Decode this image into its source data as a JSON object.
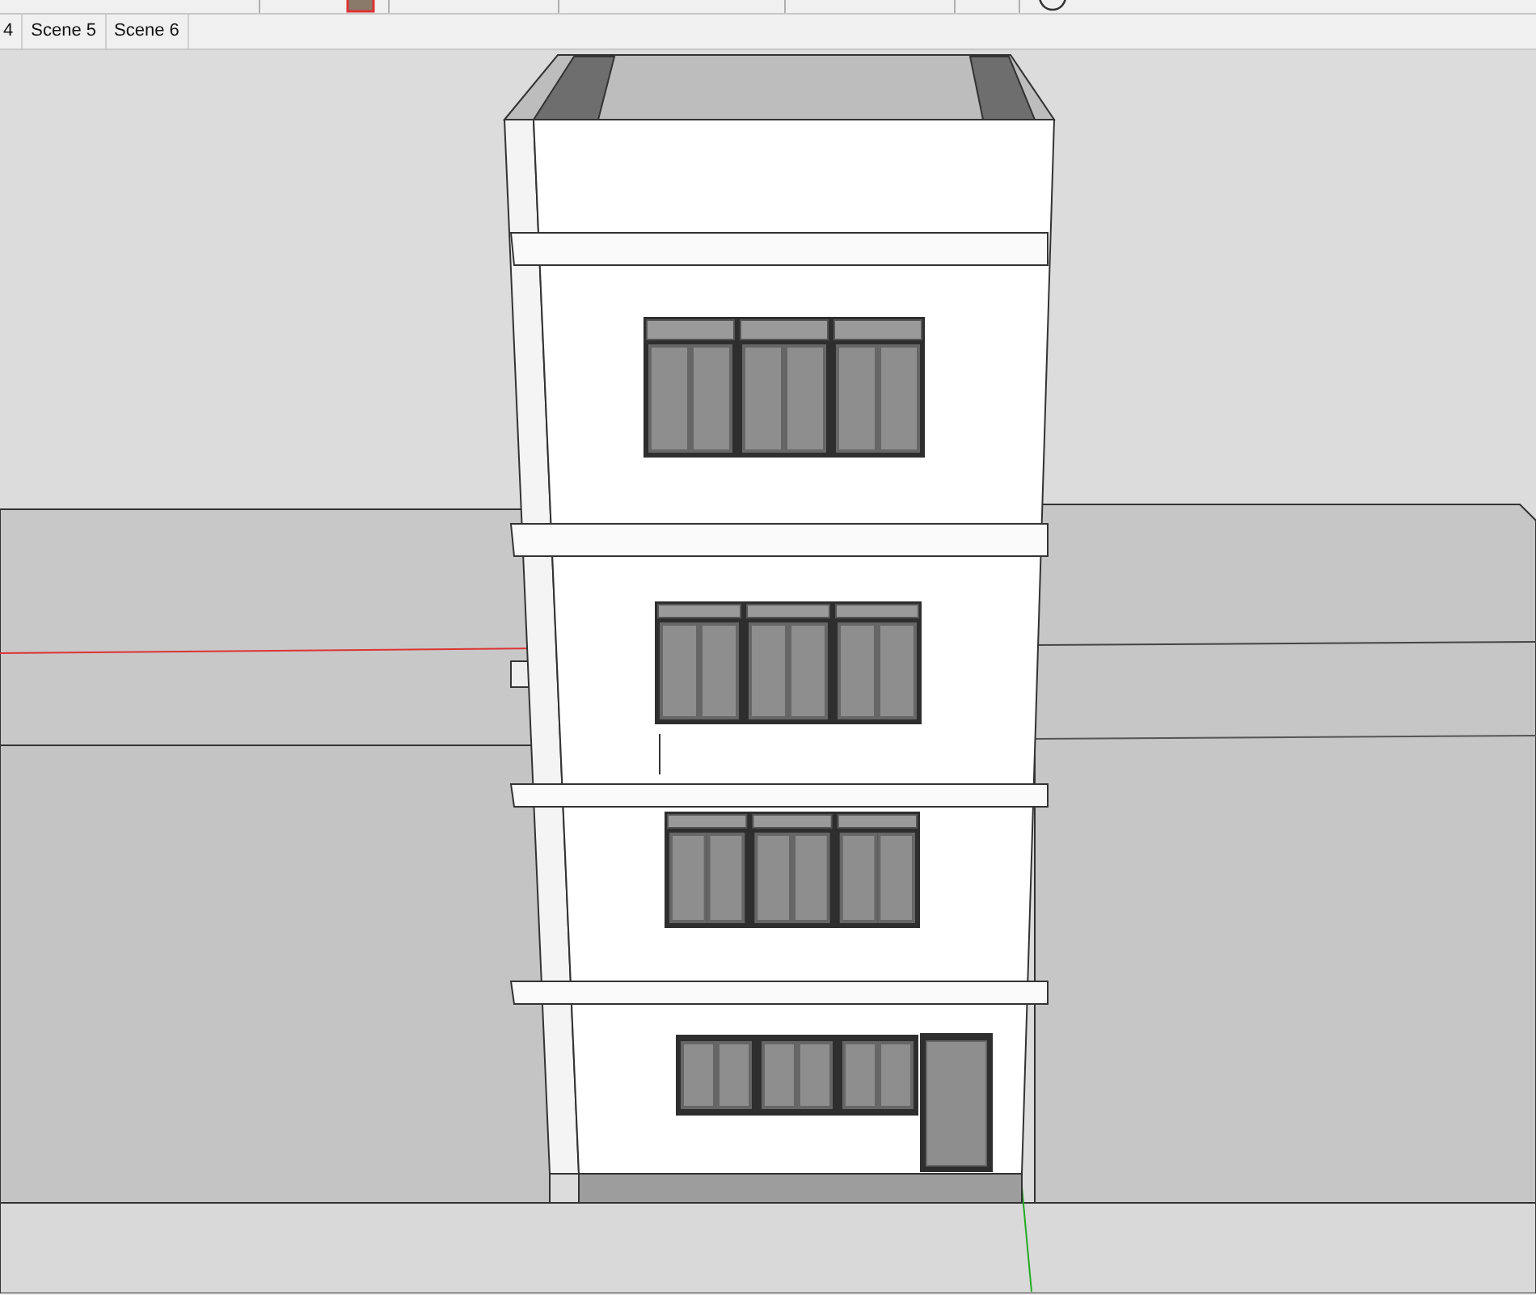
{
  "scene_tabs": [
    {
      "label": "4"
    },
    {
      "label": "Scene 5"
    },
    {
      "label": "Scene 6"
    }
  ]
}
